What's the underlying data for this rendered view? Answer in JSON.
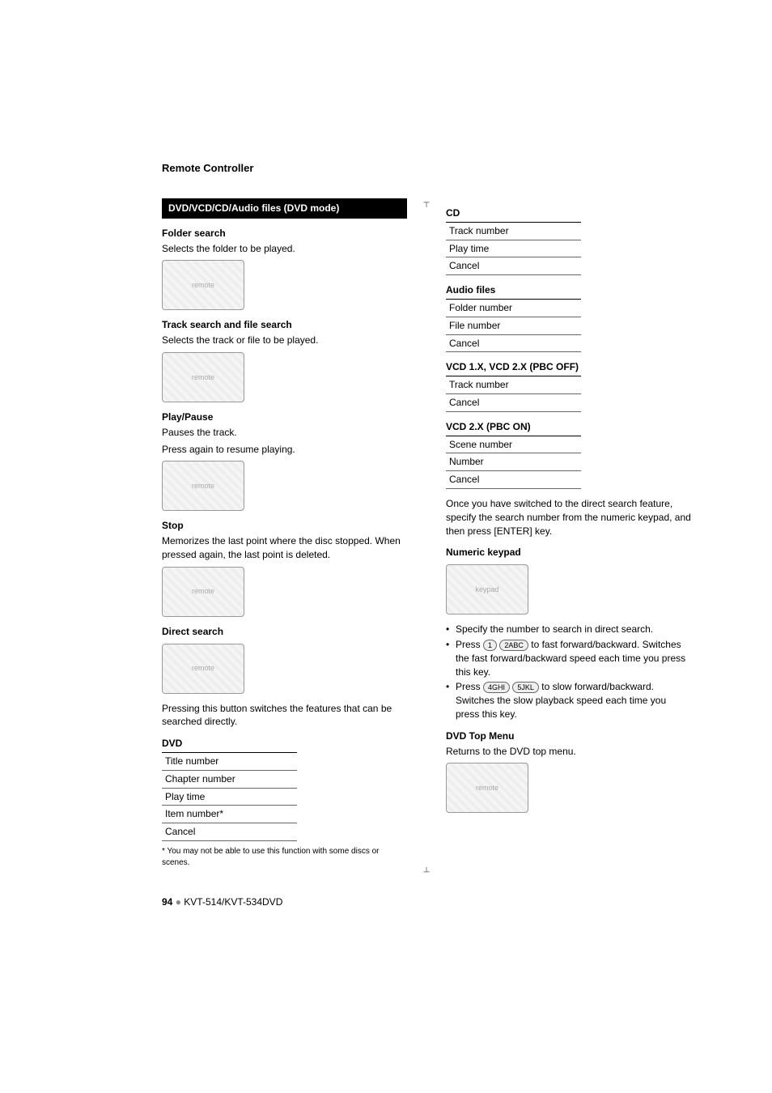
{
  "header": {
    "title": "Remote Controller"
  },
  "left": {
    "mode_bar": "DVD/VCD/CD/Audio files (DVD mode)",
    "folder_search": {
      "heading": "Folder search",
      "desc": "Selects the folder to be played."
    },
    "track_search": {
      "heading": "Track search and file search",
      "desc": "Selects the track or file to be played."
    },
    "play_pause": {
      "heading": "Play/Pause",
      "desc1": "Pauses the track.",
      "desc2": "Press again to resume playing."
    },
    "stop": {
      "heading": "Stop",
      "desc": "Memorizes the last point where the disc stopped. When pressed again, the last point is deleted."
    },
    "direct_search": {
      "heading": "Direct search",
      "desc": "Pressing this button switches the features that can be searched directly."
    },
    "dvd": {
      "heading": "DVD",
      "rows": [
        "Title number",
        "Chapter number",
        "Play time",
        "Item number*",
        "Cancel"
      ],
      "footnote": "* You may not be able to use this function with some discs or scenes."
    }
  },
  "right": {
    "cd": {
      "heading": "CD",
      "rows": [
        "Track number",
        "Play time",
        "Cancel"
      ]
    },
    "audio_files": {
      "heading": "Audio files",
      "rows": [
        "Folder number",
        "File number",
        "Cancel"
      ]
    },
    "vcd_off": {
      "heading": "VCD 1.X, VCD 2.X (PBC OFF)",
      "rows": [
        "Track number",
        "Cancel"
      ]
    },
    "vcd_on": {
      "heading": "VCD 2.X (PBC ON)",
      "rows": [
        "Scene number",
        "Number",
        "Cancel"
      ]
    },
    "after_switch": "Once you have switched to the direct search feature, specify the search number from the numeric keypad, and then press [ENTER] key.",
    "numeric_keypad": {
      "heading": "Numeric keypad"
    },
    "bullets": {
      "b1": "Specify the number to search in direct search.",
      "b2_pre": "Press ",
      "b2_btn1": "1",
      "b2_btn2": "2ABC",
      "b2_post": " to fast forward/backward. Switches the fast forward/backward speed each time you press this key.",
      "b3_pre": "Press ",
      "b3_btn1": "4GHI",
      "b3_btn2": "5JKL",
      "b3_post": " to slow forward/backward. Switches the slow playback speed each time you press this key."
    },
    "top_menu": {
      "heading": "DVD Top Menu",
      "desc": "Returns to the DVD top menu."
    }
  },
  "footer": {
    "page": "94",
    "model": "KVT-514/KVT-534DVD"
  }
}
